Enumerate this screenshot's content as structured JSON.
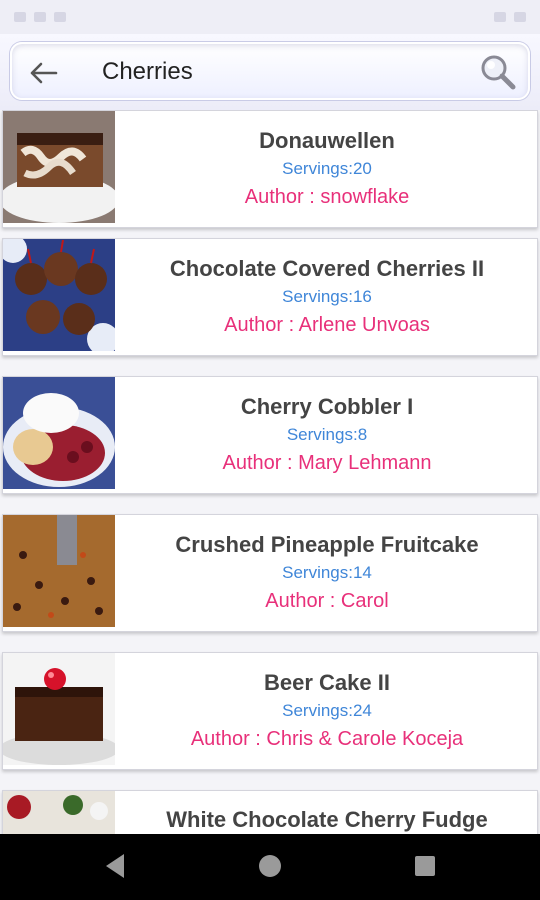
{
  "search": {
    "query": "Cherries"
  },
  "recipes": [
    {
      "title": "Donauwellen",
      "servings": "Servings:20",
      "author": "Author : snowflake"
    },
    {
      "title": "Chocolate Covered Cherries II",
      "servings": "Servings:16",
      "author": "Author : Arlene Unvoas"
    },
    {
      "title": "Cherry Cobbler I",
      "servings": "Servings:8",
      "author": "Author : Mary Lehmann"
    },
    {
      "title": "Crushed Pineapple Fruitcake",
      "servings": "Servings:14",
      "author": "Author : Carol"
    },
    {
      "title": "Beer Cake II",
      "servings": "Servings:24",
      "author": "Author : Chris & Carole Koceja"
    },
    {
      "title": "White Chocolate Cherry Fudge",
      "servings": "",
      "author": ""
    }
  ],
  "icons": {
    "back": "back-arrow-icon",
    "search": "search-icon",
    "nav_back": "triangle-back-icon",
    "nav_home": "circle-home-icon",
    "nav_recents": "square-recents-icon"
  },
  "colors": {
    "servings": "#3f86d8",
    "author": "#e8307a",
    "title": "#444444"
  }
}
